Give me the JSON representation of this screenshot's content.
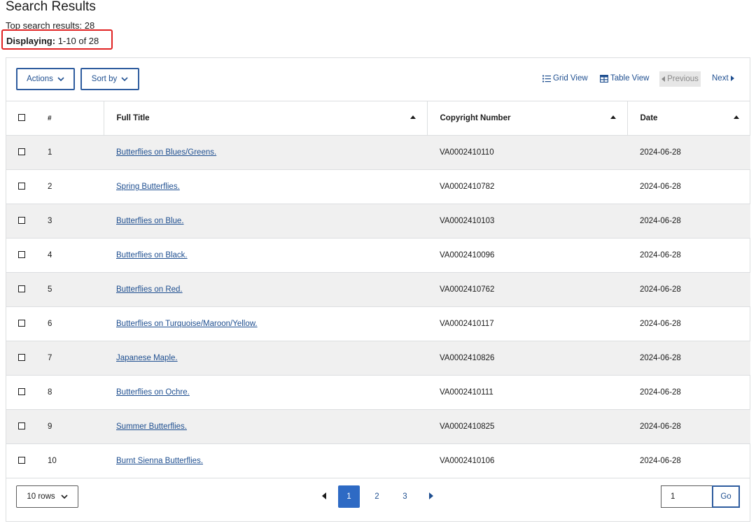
{
  "page": {
    "title": "Search Results",
    "summary_label": "Top search results:",
    "summary_count": "28",
    "displaying_label": "Displaying:",
    "displaying_value": "1-10 of 28"
  },
  "toolbar": {
    "actions_label": "Actions",
    "sort_label": "Sort by",
    "grid_view_label": "Grid View",
    "table_view_label": "Table View",
    "previous_label": "Previous",
    "next_label": "Next"
  },
  "table": {
    "columns": [
      "#",
      "Full Title",
      "Copyright Number",
      "Date"
    ],
    "rows": [
      {
        "num": "1",
        "title": "Butterflies on Blues/Greens.",
        "copyright": "VA0002410110",
        "date": "2024-06-28"
      },
      {
        "num": "2",
        "title": "Spring Butterflies.",
        "copyright": "VA0002410782",
        "date": "2024-06-28"
      },
      {
        "num": "3",
        "title": "Butterflies on Blue.",
        "copyright": "VA0002410103",
        "date": "2024-06-28"
      },
      {
        "num": "4",
        "title": "Butterflies on Black.",
        "copyright": "VA0002410096",
        "date": "2024-06-28"
      },
      {
        "num": "5",
        "title": "Butterflies on Red.",
        "copyright": "VA0002410762",
        "date": "2024-06-28"
      },
      {
        "num": "6",
        "title": "Butterflies on Turquoise/Maroon/Yellow.",
        "copyright": "VA0002410117",
        "date": "2024-06-28"
      },
      {
        "num": "7",
        "title": "Japanese Maple.",
        "copyright": "VA0002410826",
        "date": "2024-06-28"
      },
      {
        "num": "8",
        "title": "Butterflies on Ochre.",
        "copyright": "VA0002410111",
        "date": "2024-06-28"
      },
      {
        "num": "9",
        "title": "Summer Butterflies.",
        "copyright": "VA0002410825",
        "date": "2024-06-28"
      },
      {
        "num": "10",
        "title": "Burnt Sienna Butterflies.",
        "copyright": "VA0002410106",
        "date": "2024-06-28"
      }
    ]
  },
  "footer": {
    "rows_label": "10 rows",
    "pages": [
      "1",
      "2",
      "3"
    ],
    "current_page": "1",
    "goto_value": "1",
    "go_label": "Go"
  },
  "icons": [
    "chevron-down-icon",
    "list-icon",
    "table-icon",
    "caret-left-icon",
    "caret-right-icon",
    "sort-ascending-icon",
    "checkbox-icon"
  ],
  "colors": {
    "accent": "#1f4f90",
    "active_page": "#2e6ac4",
    "highlight_box": "#e02222",
    "row_stripe": "#f0f0f0"
  }
}
